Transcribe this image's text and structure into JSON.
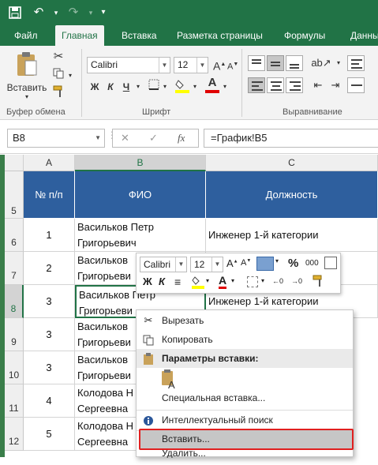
{
  "qat": {
    "save_icon": "save-icon",
    "undo_icon": "undo-icon",
    "redo_icon": "redo-icon",
    "customize_icon": "customize-qat-icon"
  },
  "tabs": [
    "Файл",
    "Главная",
    "Вставка",
    "Разметка страницы",
    "Формулы",
    "Данны"
  ],
  "active_tab": "Главная",
  "ribbon": {
    "paste_label": "Вставить",
    "clipboard_group": "Буфер обмена",
    "font_group": "Шрифт",
    "align_group": "Выравнивание",
    "font_name": "Calibri",
    "font_size": "12",
    "bold": "Ж",
    "italic": "К",
    "underline": "Ч",
    "font_color": "A"
  },
  "formula_bar": {
    "name_box": "B8",
    "fx": "fx",
    "cancel": "✕",
    "enter": "✓",
    "formula": "=График!B5"
  },
  "columns": [
    "A",
    "B",
    "C"
  ],
  "rows": [
    {
      "num": "5",
      "a": "№ п/п",
      "b": "ФИО",
      "c": "Должность"
    },
    {
      "num": "6",
      "a": "1",
      "b1": "Васильков Петр",
      "b2": "Григорьевич",
      "c": "Инженер 1-й категории"
    },
    {
      "num": "7",
      "a": "2",
      "b1": "Васильков",
      "b2": "Григорьеви"
    },
    {
      "num": "8",
      "a": "3",
      "b1": "Васильков Петр",
      "b2": "Григорьеви",
      "c": "Инженер 1-й категории"
    },
    {
      "num": "9",
      "a": "3",
      "b1": "Васильков",
      "b2": "Григорьеви"
    },
    {
      "num": "10",
      "a": "3",
      "b1": "Васильков",
      "b2": "Григорьеви"
    },
    {
      "num": "11",
      "a": "4",
      "b1": "Колодова Н",
      "b2": "Сергеевна"
    },
    {
      "num": "12",
      "a": "5",
      "b1": "Колодова Н",
      "b2": "Сергеевна"
    }
  ],
  "mini_toolbar": {
    "font": "Calibri",
    "size": "12",
    "percent": "%",
    "thousands": "000",
    "bold": "Ж",
    "italic": "К",
    "font_color": "A"
  },
  "context_menu": {
    "cut": "Вырезать",
    "copy": "Копировать",
    "paste_options_header": "Параметры вставки:",
    "paste_special": "Специальная вставка...",
    "smart_lookup": "Интеллектуальный поиск",
    "insert": "Вставить...",
    "delete": "Удалить..."
  },
  "colors": {
    "brand": "#217346",
    "header_fill": "#2e5f9e",
    "highlight_border": "#e02020"
  }
}
